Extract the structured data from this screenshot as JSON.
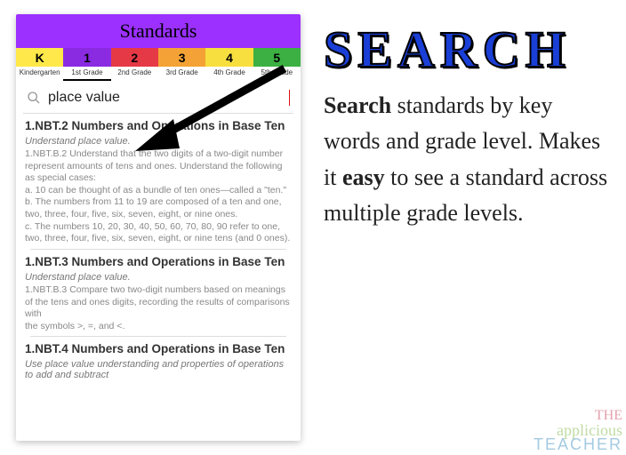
{
  "app": {
    "title": "Standards",
    "gradeTabs": [
      {
        "num": "K",
        "label": "Kindergarten"
      },
      {
        "num": "1",
        "label": "1st Grade"
      },
      {
        "num": "2",
        "label": "2nd Grade"
      },
      {
        "num": "3",
        "label": "3rd Grade"
      },
      {
        "num": "4",
        "label": "4th Grade"
      },
      {
        "num": "5",
        "label": "5th Grade"
      }
    ],
    "search": {
      "placeholder": "Search",
      "value": "place value"
    },
    "results": [
      {
        "title": "1.NBT.2 Numbers and Operations in Base Ten",
        "subtitle": "Understand place value.",
        "desc": "1.NBT.B.2 Understand that the two digits of a two-digit number represent amounts of tens and ones. Understand the following as special cases:\na. 10 can be thought of as a bundle of ten ones—called a \"ten.\"\nb. The numbers from 11 to 19 are composed of a ten and one, two, three, four, five, six, seven, eight, or nine ones.\nc. The numbers 10, 20, 30, 40, 50, 60, 70, 80, 90 refer to one, two, three, four, five, six, seven, eight, or nine tens (and 0 ones)."
      },
      {
        "title": "1.NBT.3 Numbers and Operations in Base Ten",
        "subtitle": "Understand place value.",
        "desc": "1.NBT.B.3 Compare two two-digit numbers based on meanings of the tens and ones digits, recording the results of comparisons with\nthe symbols >, =, and <."
      },
      {
        "title": "1.NBT.4 Numbers and Operations in Base Ten",
        "subtitle": "Use place value understanding and properties of operations to add and subtract",
        "desc": ""
      }
    ]
  },
  "promo": {
    "headline": "SEARCH",
    "body_parts": {
      "p1a": "Search",
      "p1b": " standards by key words and grade level. Makes it ",
      "p1c": "easy",
      "p1d": " to see a standard across multiple grade levels."
    }
  },
  "watermark": {
    "line1": "THE",
    "line2": "applicious",
    "line3": "TEACHER"
  }
}
